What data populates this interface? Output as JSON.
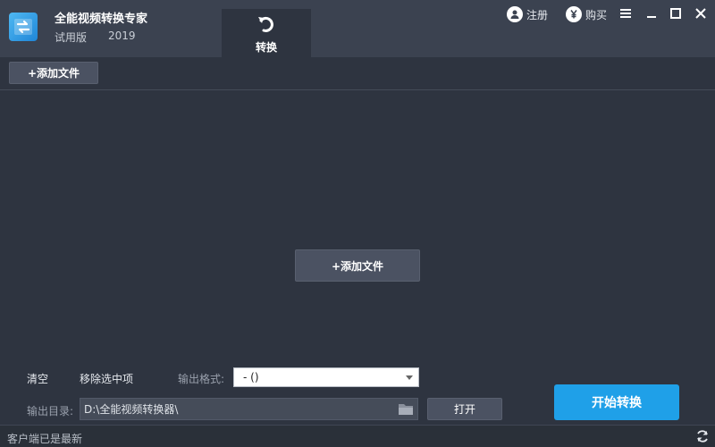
{
  "app": {
    "title": "全能视频转换专家",
    "edition": "试用版",
    "year": "2019"
  },
  "tabs": [
    {
      "label": "转换",
      "icon": "convert-arrow-icon",
      "active": true
    }
  ],
  "header_links": {
    "register_label": "注册",
    "register_icon": "user-icon",
    "buy_label": "购买",
    "buy_icon": "yen-icon"
  },
  "window_controls": [
    "menu-icon",
    "minimize-icon",
    "maximize-icon",
    "close-icon"
  ],
  "toolbar": {
    "add_file_label": "+添加文件"
  },
  "content": {
    "add_file_label": "+添加文件"
  },
  "bottom": {
    "clear_label": "清空",
    "remove_selected_label": "移除选中项",
    "output_format_label": "输出格式:",
    "output_format_value": "- ()",
    "output_dir_label": "输出目录:",
    "output_dir_value": "D:\\全能视频转换器\\",
    "open_label": "打开",
    "start_label": "开始转换"
  },
  "status": {
    "text": "客户端已是最新"
  },
  "colors": {
    "background": "#2e3440",
    "titlebar": "#3b4250",
    "accent": "#1fa0e8"
  }
}
